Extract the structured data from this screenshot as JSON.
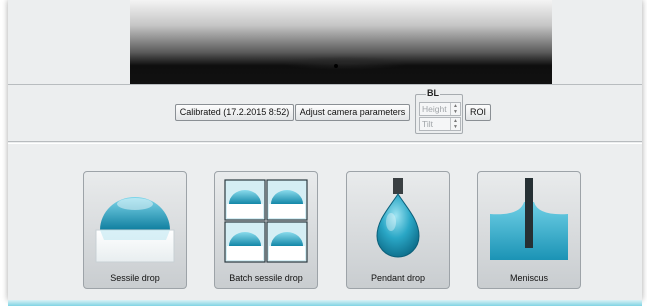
{
  "toolbar": {
    "calibrated_label": "Calibrated (17.2.2015 8:52)",
    "adjust_camera_label": "Adjust camera parameters",
    "roi_label": "ROI"
  },
  "baseline": {
    "title": "BL",
    "height_label": "Height",
    "tilt_label": "Tilt"
  },
  "methods": [
    {
      "label": "Sessile drop",
      "icon": "sessile-drop-icon"
    },
    {
      "label": "Batch sessile drop",
      "icon": "batch-sessile-drop-icon"
    },
    {
      "label": "Pendant drop",
      "icon": "pendant-drop-icon"
    },
    {
      "label": "Meniscus",
      "icon": "meniscus-icon"
    }
  ],
  "colors": {
    "accent": "#2aa7c6",
    "accent_dark": "#0f6f8c",
    "window_bg": "#eceeef"
  }
}
